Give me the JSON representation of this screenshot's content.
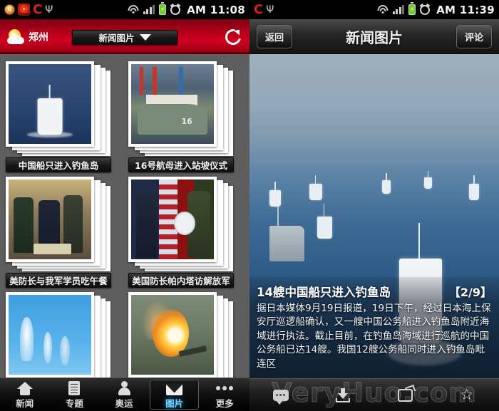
{
  "left": {
    "statusbar": {
      "badge_count": "6",
      "icons": [
        "notification-badge",
        "app-swirl-icon",
        "c-logo-icon",
        "usb-icon",
        "wifi-icon",
        "signal-icon",
        "battery-charging-icon",
        "alarm-icon"
      ],
      "time": "AM 11:08"
    },
    "header": {
      "city": "郑州",
      "weather_icon": "sun-cloud-icon",
      "title": "新闻图片",
      "dropdown_icon": "caret-down-icon",
      "refresh_icon": "refresh-icon"
    },
    "gallery": [
      {
        "caption": "中国船只进入钓鱼岛",
        "art": "ph-sea"
      },
      {
        "caption": "16号航母进入站坡仪式",
        "art": "ph-port",
        "ship_number": "16"
      },
      {
        "caption": "美防长与我军学员吃午餐",
        "art": "ph-lunch"
      },
      {
        "caption": "美国防长帕内塔访解放军",
        "art": "ph-flag"
      },
      {
        "caption": "",
        "art": "ph-sky"
      },
      {
        "caption": "",
        "art": "ph-fire"
      }
    ],
    "tabs": [
      {
        "label": "新闻",
        "icon": "home-icon",
        "active": false
      },
      {
        "label": "专题",
        "icon": "document-icon",
        "active": false
      },
      {
        "label": "奥运",
        "icon": "person-icon",
        "active": false
      },
      {
        "label": "图片",
        "icon": "envelope-icon",
        "active": true
      },
      {
        "label": "更多",
        "icon": "more-dots-icon",
        "active": false
      }
    ]
  },
  "right": {
    "statusbar": {
      "icons": [
        "c-logo-icon",
        "usb-icon",
        "wifi-icon",
        "signal-icon",
        "battery-charging-icon",
        "alarm-icon"
      ],
      "time": "AM 11:39"
    },
    "header": {
      "back_label": "返回",
      "title": "新闻图片",
      "comment_label": "评论"
    },
    "photo": {
      "title": "14艘中国船只进入钓鱼岛",
      "counter": "【2/9】",
      "body": "据日本媒体9月19日报道，19日下午，经过日本海上保安厅巡逻船确认，又一艘中国公务船进入钓鱼岛附近海域进行执法。截止目前，在钓鱼岛海域进行巡航的中国公务船已达14艘。我国12艘公务船同时进入钓鱼岛毗连区"
    },
    "toolbar": {
      "watermark": "VeryHuo.com",
      "items": [
        "comment-icon",
        "download-icon",
        "share-icon",
        "favorite-star-icon"
      ]
    }
  },
  "colors": {
    "header_red": "#c2001c",
    "accent_blue": "#6fd2ff",
    "gallery_bg": "#5e5e5e"
  }
}
